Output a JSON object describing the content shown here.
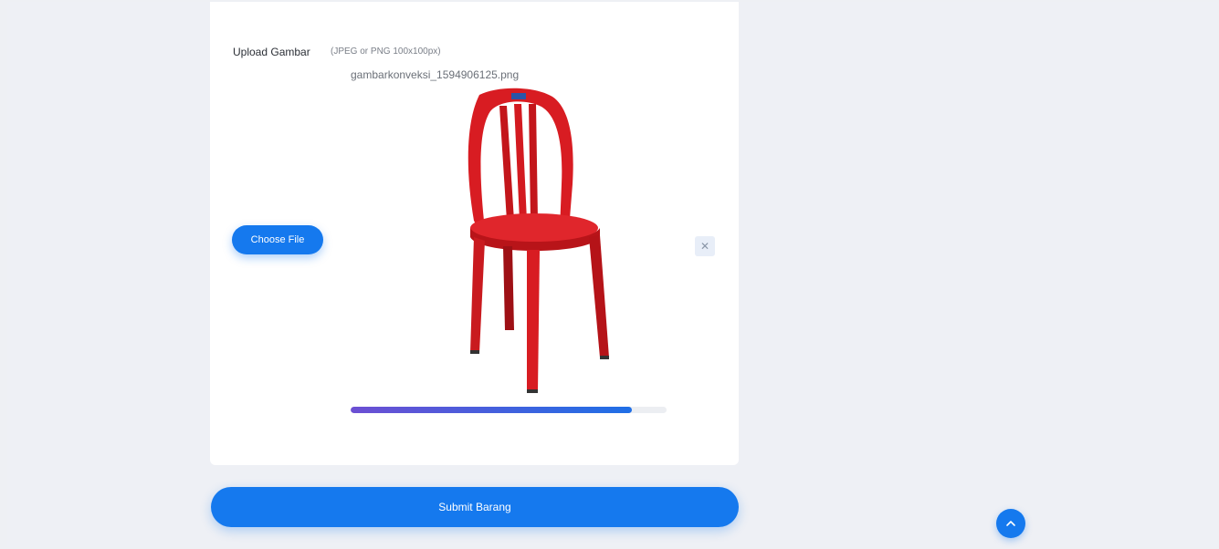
{
  "form": {
    "upload_label": "Upload Gambar",
    "upload_hint": "(JPEG or PNG 100x100px)",
    "file_name": "gambarkonveksi_1594906125.png",
    "choose_file_label": "Choose File",
    "remove_icon": "close-icon",
    "upload_progress": 0.89,
    "submit_label": "Submit Barang"
  },
  "preview_image": {
    "subject": "red plastic chair"
  },
  "scroll_top_icon": "chevron-up-icon",
  "colors": {
    "primary": "#1579ee",
    "background": "#eef0f4",
    "card": "#ffffff",
    "chair": "#d81c22",
    "progress_start": "#6c4fd3",
    "progress_end": "#1f6fe6"
  }
}
